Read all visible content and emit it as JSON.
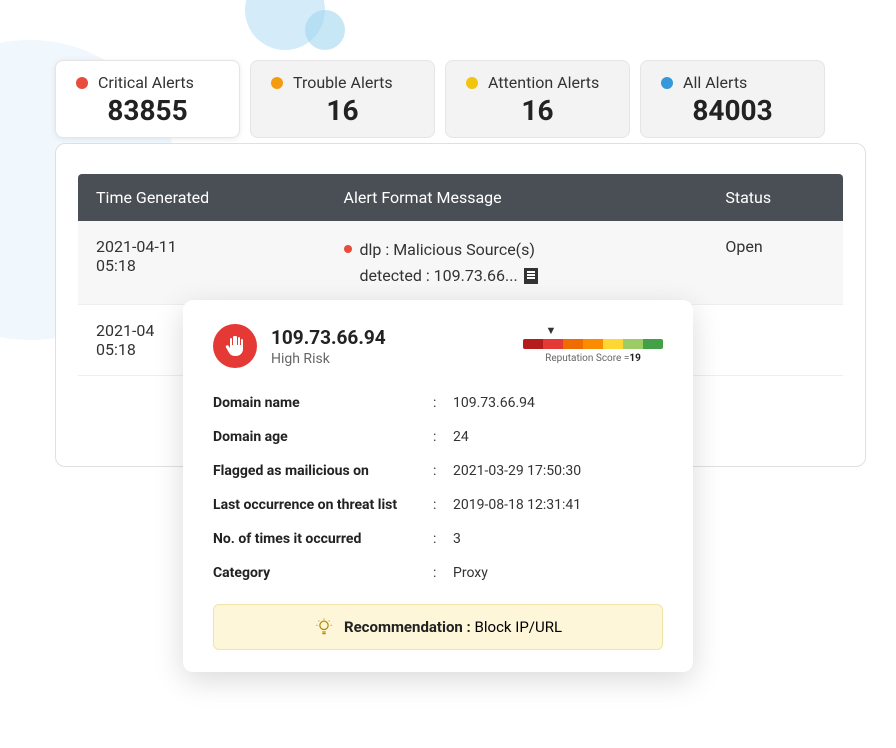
{
  "tabs": [
    {
      "label": "Critical Alerts",
      "count": "83855",
      "color": "#e74c3c",
      "active": true
    },
    {
      "label": "Trouble Alerts",
      "count": "16",
      "color": "#f39c12",
      "active": false
    },
    {
      "label": "Attention Alerts",
      "count": "16",
      "color": "#f1c40f",
      "active": false
    },
    {
      "label": "All Alerts",
      "count": "84003",
      "color": "#3498db",
      "active": false
    }
  ],
  "columns": {
    "time": "Time Generated",
    "msg": "Alert Format Message",
    "status": "Status"
  },
  "rows": [
    {
      "time_l1": "2021-04-11",
      "time_l2": "05:18",
      "msg_l1": "dlp : Malicious Source(s)",
      "msg_l2": "detected : 109.73.66...",
      "status": "Open"
    },
    {
      "time_l1": "2021-04",
      "time_l2": "05:18",
      "msg_l1": "",
      "msg_l2": "",
      "status": ""
    }
  ],
  "popover": {
    "ip": "109.73.66.94",
    "risk": "High Risk",
    "rep_label_pre": "Reputation Score =",
    "rep_score": "19",
    "rep_colors": [
      "#b71c1c",
      "#e53935",
      "#ef6c00",
      "#fb8c00",
      "#fdd835",
      "#9ccc65",
      "#43a047"
    ],
    "details": [
      {
        "label": "Domain name",
        "value": "109.73.66.94"
      },
      {
        "label": "Domain age",
        "value": "24"
      },
      {
        "label": "Flagged as mailicious on",
        "value": "2021-03-29 17:50:30"
      },
      {
        "label": "Last occurrence on threat list",
        "value": "2019-08-18 12:31:41"
      },
      {
        "label": "No. of times it occurred",
        "value": "3"
      },
      {
        "label": "Category",
        "value": "Proxy"
      }
    ],
    "reco_label": "Recommendation :",
    "reco_value": "Block IP/URL"
  }
}
